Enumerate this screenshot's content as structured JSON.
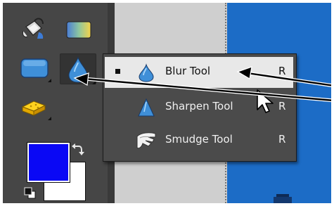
{
  "toolbox": {
    "tools": [
      {
        "name": "Paint Bucket Tool",
        "icon": "paint-bucket-icon"
      },
      {
        "name": "Gradient Tool",
        "icon": "gradient-icon"
      },
      {
        "name": "Shape Tool",
        "icon": "rounded-rectangle-icon"
      },
      {
        "name": "Blur Tool",
        "icon": "blur-drop-icon",
        "active": true
      },
      {
        "name": "Sponge Tool",
        "icon": "sponge-icon"
      }
    ],
    "foreground_color": "#0a08f5",
    "background_color": "#ffffff"
  },
  "flyout": {
    "items": [
      {
        "label": "Blur Tool",
        "shortcut": "R",
        "icon": "blur-drop-icon",
        "selected": true
      },
      {
        "label": "Sharpen Tool",
        "shortcut": "R",
        "icon": "sharpen-triangle-icon",
        "selected": false
      },
      {
        "label": "Smudge Tool",
        "shortcut": "R",
        "icon": "smudge-finger-icon",
        "selected": false
      }
    ]
  },
  "colors": {
    "panel": "#464646",
    "menu_bg": "#4b4b4b",
    "menu_selected": "#e8e8e8",
    "canvas_gray": "#cfcfcf",
    "canvas_blue": "#1c6cc6",
    "tool_icon_blue": "#3f8fd8"
  }
}
